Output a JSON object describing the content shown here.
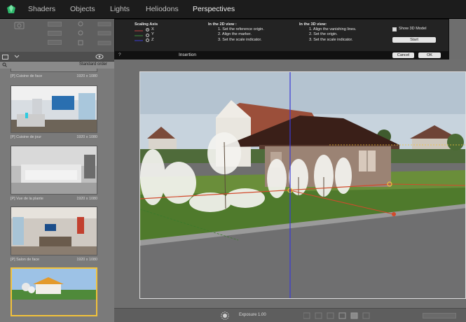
{
  "menu": {
    "tabs": [
      "Shaders",
      "Objects",
      "Lights",
      "Heliodons",
      "Perspectives"
    ],
    "active": "Perspectives"
  },
  "dialog": {
    "scaling_axis": {
      "title": "Scaling Axis",
      "options": [
        "X",
        "Y",
        "Z"
      ],
      "selected": "X"
    },
    "view2d": {
      "title": "In the 2D view :",
      "steps": [
        "1. Set the reference origin.",
        "2. Align the marker.",
        "3. Set the scale indicator."
      ]
    },
    "view3d": {
      "title": "In the 3D view:",
      "steps": [
        "1. Align the vanishing lines.",
        "2. Set the origin.",
        "3. Set the scale indicator."
      ]
    },
    "show3d_label": "Show 3D Model",
    "start_label": "Start",
    "cancel_label": "Cancel",
    "ok_label": "OK",
    "title": "Insertion",
    "help_label": "?"
  },
  "left_panel": {
    "sort_label": "Standard order",
    "items": [
      {
        "name": "[P] Cuisine de face",
        "size": "1920 x 1080"
      },
      {
        "name": "[P] Cuisine de jour",
        "size": "1920 x 1080"
      },
      {
        "name": "[P] Vue de la plante",
        "size": "1920 x 1080"
      },
      {
        "name": "[P] Salon de face",
        "size": "1920 x 1080"
      }
    ]
  },
  "statusbar": {
    "exposure_label": "Exposure 1.00"
  },
  "colors": {
    "accent": "#f2c23a",
    "selection_border": "#f2c23a",
    "guide_line": "#3b3bd6"
  }
}
